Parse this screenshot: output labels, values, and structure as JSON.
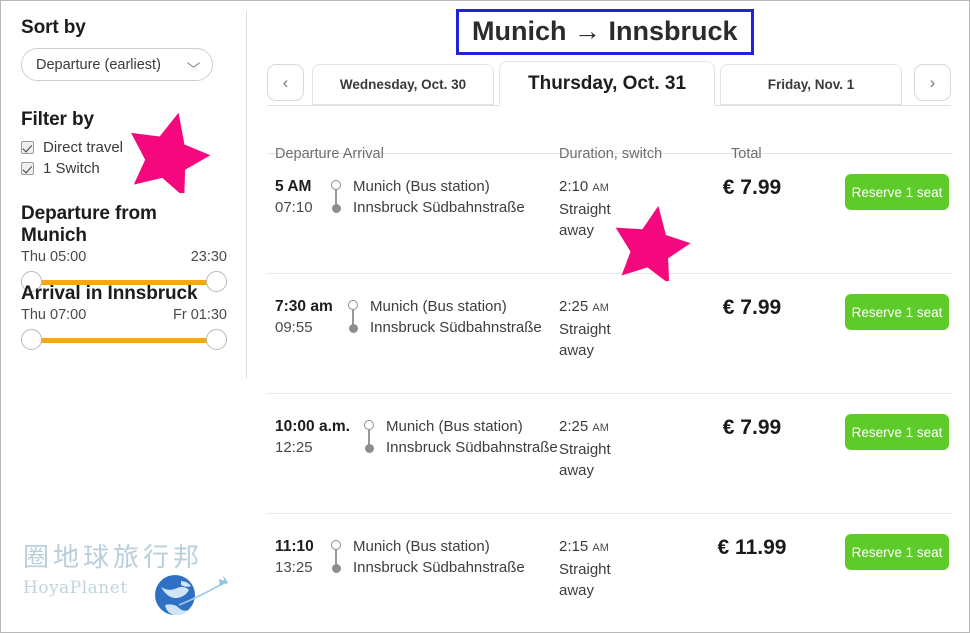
{
  "header": {
    "title": "Munich → Innsbruck"
  },
  "sidebar": {
    "sort": {
      "heading": "Sort by",
      "selected": "Departure (earliest)",
      "chevron_icon": "chevron-down-icon"
    },
    "filter": {
      "heading": "Filter by",
      "options": [
        {
          "label": "Direct travel",
          "checked": true
        },
        {
          "label": "1 Switch",
          "checked": true
        }
      ]
    },
    "departure_slider": {
      "heading": "Departure from Munich",
      "min_label": "Thu 05:00",
      "max_label": "23:30",
      "track_color": "#f5a623"
    },
    "arrival_slider": {
      "heading": "Arrival in Innsbruck",
      "min_label": "Thu 07:00",
      "max_label": "Fr 01:30",
      "track_color": "#f5a623"
    }
  },
  "watermark": {
    "chinese": "圈地球旅行邦",
    "latin": "HoyaPlanet"
  },
  "date_nav": {
    "prev_icon": "chevron-left-icon",
    "next_icon": "chevron-right-icon",
    "prev_day": "Wednesday, Oct. 30",
    "active_day": "Thursday, Oct. 31",
    "next_day": "Friday, Nov. 1"
  },
  "table": {
    "columns": {
      "departure_arrival": "Departure Arrival",
      "duration_switch": "Duration, switch",
      "total": "Total"
    },
    "rows": [
      {
        "departure_time": "5 AM",
        "arrival_time": "07:10",
        "origin": "Munich (Bus station)",
        "destination": "Innsbruck Südbahnstraße",
        "duration": "2:10",
        "duration_unit": "AM",
        "switch_line1": "Straight",
        "switch_line2": "away",
        "price": "€ 7.99",
        "button_label": "Reserve 1 seat"
      },
      {
        "departure_time": "7:30 am",
        "arrival_time": "09:55",
        "origin": "Munich (Bus station)",
        "destination": "Innsbruck Südbahnstraße",
        "duration": "2:25",
        "duration_unit": "AM",
        "switch_line1": "Straight",
        "switch_line2": "away",
        "price": "€ 7.99",
        "button_label": "Reserve 1 seat"
      },
      {
        "departure_time": "10:00 a.m.",
        "arrival_time": "12:25",
        "origin": "Munich (Bus station)",
        "destination": "Innsbruck Südbahnstraße",
        "duration": "2:25",
        "duration_unit": "AM",
        "switch_line1": "Straight",
        "switch_line2": "away",
        "price": "€ 7.99",
        "button_label": "Reserve 1 seat"
      },
      {
        "departure_time": "11:10",
        "arrival_time": "13:25",
        "origin": "Munich (Bus station)",
        "destination": "Innsbruck Südbahnstraße",
        "duration": "2:15",
        "duration_unit": "AM",
        "switch_line1": "Straight",
        "switch_line2": "away",
        "price": "€ 11.99",
        "button_label": "Reserve 1 seat"
      }
    ]
  },
  "annotations": {
    "star_color": "#f5087e",
    "title_border_color": "#2222dd",
    "reserve_button_color": "#5ecb2a"
  }
}
